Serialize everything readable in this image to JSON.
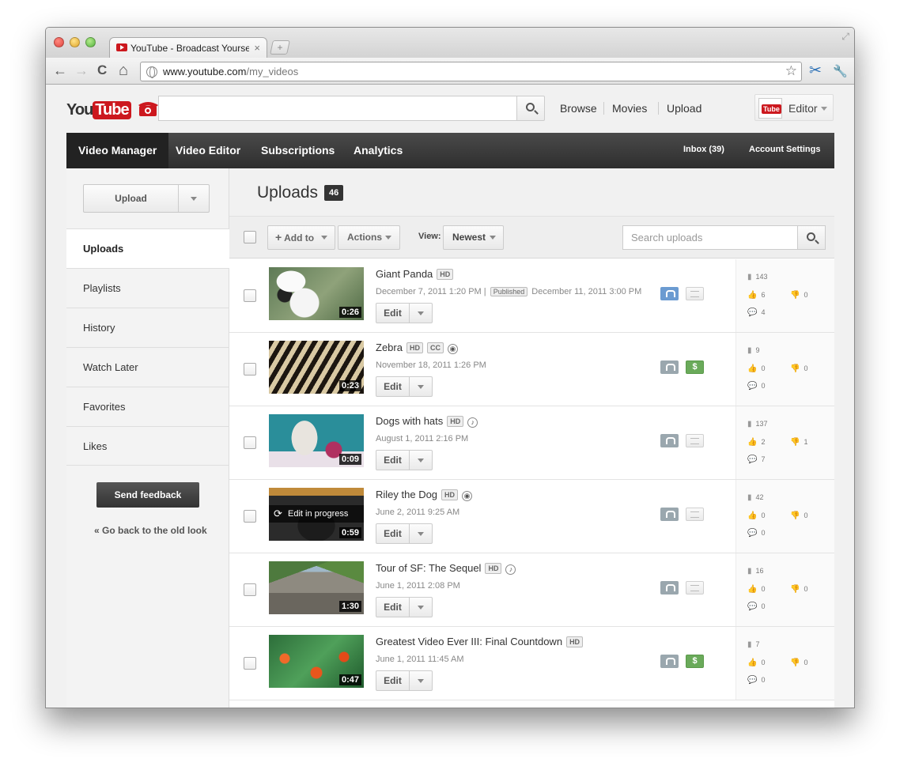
{
  "browser": {
    "tab_title": "YouTube - Broadcast Yourse",
    "tab_close": "×",
    "new_tab": "+",
    "url_host": "www.youtube.com",
    "url_path": "/my_videos",
    "nav_back": "←",
    "nav_forward": "→",
    "nav_reload": "C",
    "nav_home": "⌂",
    "bookmark": "☆",
    "ext_scissors": "✂",
    "ext_wrench": "🔧"
  },
  "masthead": {
    "logo_you": "You",
    "logo_tube": "Tube",
    "nav": [
      "Browse",
      "Movies",
      "Upload"
    ],
    "user_name": "Editor",
    "avatar_text": "Tube"
  },
  "primary_nav": {
    "items": [
      "Video Manager",
      "Video Editor",
      "Subscriptions",
      "Analytics"
    ],
    "right": [
      "Inbox (39)",
      "Account Settings"
    ]
  },
  "sidebar": {
    "upload_label": "Upload",
    "items": [
      "Uploads",
      "Playlists",
      "History",
      "Watch Later",
      "Favorites",
      "Likes"
    ],
    "feedback_label": "Send feedback",
    "old_look_label": "«  Go back to the old look"
  },
  "main": {
    "title": "Uploads",
    "count": "46",
    "add_to_label": "Add to",
    "actions_label": "Actions",
    "view_label": "View:",
    "sort_value": "Newest",
    "search_placeholder": "Search uploads"
  },
  "videos": [
    {
      "title": "Giant Panda",
      "badges": [
        "HD"
      ],
      "date": "December 7, 2011 1:20 PM  |",
      "published_badge": "Published",
      "published_date": "December 11, 2011 3:00 PM",
      "duration": "0:26",
      "edit_label": "Edit",
      "views": "143",
      "likes": "6",
      "dislikes": "0",
      "comments": "4",
      "privacy": "public",
      "monetized": false
    },
    {
      "title": "Zebra",
      "badges": [
        "HD",
        "CC"
      ],
      "icon": "◉",
      "date": "November 18, 2011 1:26 PM",
      "duration": "0:23",
      "edit_label": "Edit",
      "views": "9",
      "likes": "0",
      "dislikes": "0",
      "comments": "0",
      "privacy": "private",
      "monetized": true
    },
    {
      "title": "Dogs with hats",
      "badges": [
        "HD"
      ],
      "icon": "♪",
      "date": "August 1, 2011 2:16 PM",
      "duration": "0:09",
      "edit_label": "Edit",
      "views": "137",
      "likes": "2",
      "dislikes": "1",
      "comments": "7",
      "privacy": "private",
      "monetized": false
    },
    {
      "title": "Riley the Dog",
      "badges": [
        "HD"
      ],
      "icon": "◉",
      "date": "June 2, 2011 9:25 AM",
      "duration": "0:59",
      "progress_label": "Edit in progress",
      "edit_label": "Edit",
      "views": "42",
      "likes": "0",
      "dislikes": "0",
      "comments": "0",
      "privacy": "private",
      "monetized": false
    },
    {
      "title": "Tour of SF: The Sequel",
      "badges": [
        "HD"
      ],
      "icon": "♪",
      "date": "June 1, 2011 2:08 PM",
      "duration": "1:30",
      "edit_label": "Edit",
      "views": "16",
      "likes": "0",
      "dislikes": "0",
      "comments": "0",
      "privacy": "private",
      "monetized": false
    },
    {
      "title": "Greatest Video Ever III: Final Countdown",
      "badges": [
        "HD"
      ],
      "date": "June 1, 2011 11:45 AM",
      "duration": "0:47",
      "edit_label": "Edit",
      "views": "7",
      "likes": "0",
      "dislikes": "0",
      "comments": "0",
      "privacy": "private",
      "monetized": true
    }
  ],
  "money_symbol": "$",
  "stat_icons": {
    "views": "▮",
    "likes": "👍",
    "dislikes": "👎",
    "comments": "💬"
  },
  "colors": {
    "brand_red": "#cc181e",
    "nav_dark": "#333333",
    "public_blue": "#6b9bd1",
    "money_green": "#6aaa5a"
  }
}
